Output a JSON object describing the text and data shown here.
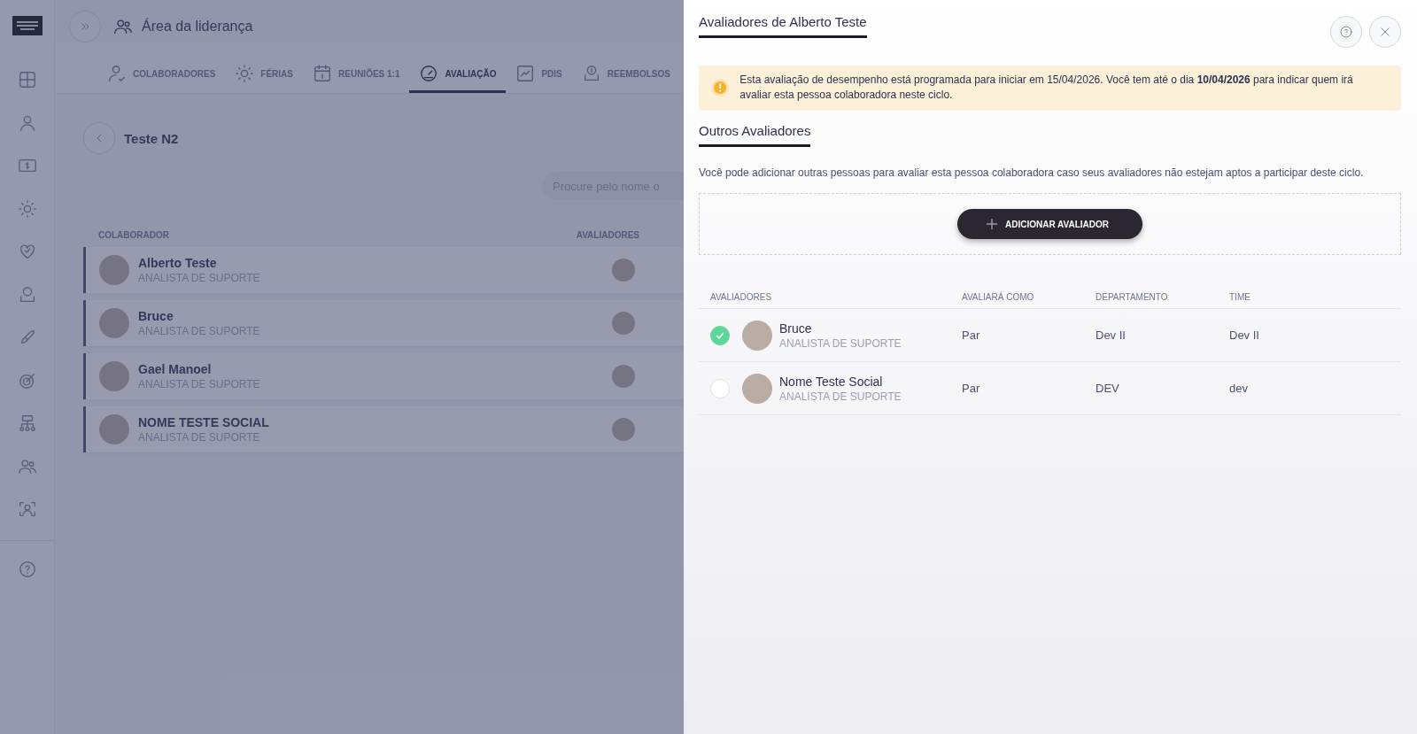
{
  "header": {
    "title": "Área da liderança"
  },
  "tabs": [
    {
      "label": "COLABORADORES",
      "selected": false
    },
    {
      "label": "FÉRIAS",
      "selected": false
    },
    {
      "label": "REUNIÕES 1:1",
      "selected": false
    },
    {
      "label": "AVALIAÇÃO",
      "selected": true
    },
    {
      "label": "PDIS",
      "selected": false
    },
    {
      "label": "REEMBOLSOS",
      "selected": false
    }
  ],
  "page": {
    "title": "Teste N2",
    "search_placeholder": "Procure pelo nome o"
  },
  "team_table": {
    "columns": [
      "COLABORADOR",
      "AVALIADORES"
    ],
    "rows": [
      {
        "name": "Alberto Teste",
        "role": "ANALISTA DE SUPORTE"
      },
      {
        "name": "Bruce",
        "role": "ANALISTA DE SUPORTE"
      },
      {
        "name": "Gael Manoel",
        "role": "ANALISTA DE SUPORTE"
      },
      {
        "name": "NOME TESTE SOCIAL",
        "role": "ANALISTA DE SUPORTE"
      }
    ]
  },
  "panel": {
    "title": "Avaliadores de Alberto Teste",
    "alert": "Esta avaliação de desempenho está programada para iniciar em 15/04/2026. Você tem até o dia **10/04/2026** para indicar quem irá avaliar esta pessoa colaboradora neste ciclo.",
    "section_title": "Outros Avaliadores",
    "description": "Você pode adicionar outras pessoas para avaliar esta pessoa colaboradora caso seus avaliadores não estejam aptos a participar deste ciclo.",
    "add_button": "ADICIONAR AVALIADOR",
    "columns": [
      "AVALIADORES",
      "AVALIARÁ COMO",
      "DEPARTAMENTO",
      "TIME"
    ],
    "rows": [
      {
        "checked": true,
        "name": "Bruce",
        "role": "ANALISTA DE SUPORTE",
        "avaliara_como": "Par",
        "departamento": "Dev II",
        "time": "Dev II"
      },
      {
        "checked": false,
        "name": "Nome Teste Social",
        "role": "ANALISTA DE SUPORTE",
        "avaliara_como": "Par",
        "departamento": "DEV",
        "time": "dev"
      }
    ]
  }
}
